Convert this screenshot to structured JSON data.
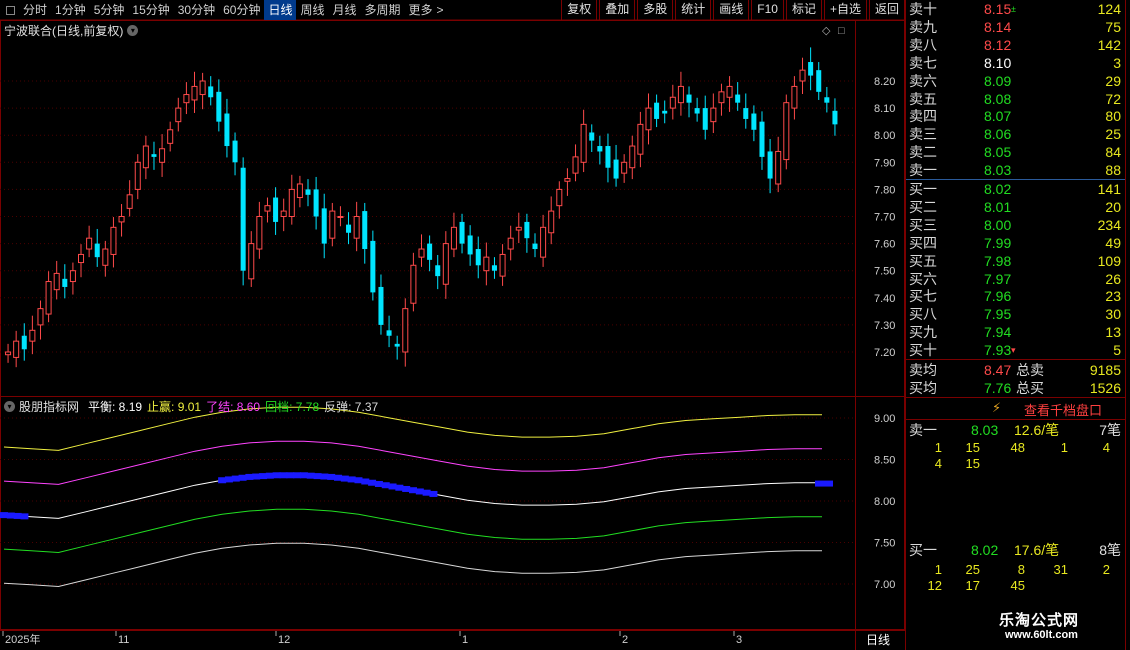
{
  "toolbar": {
    "periods": [
      "分时",
      "1分钟",
      "5分钟",
      "15分钟",
      "30分钟",
      "60分钟",
      "日线",
      "周线",
      "月线",
      "多周期",
      "更多"
    ],
    "active_period": "日线",
    "more_suffix": ">",
    "buttons": [
      "复权",
      "叠加",
      "多股",
      "统计",
      "画线",
      "F10",
      "标记",
      "+自选",
      "返回"
    ]
  },
  "stock_title": "宁波联合(日线,前复权)",
  "price_axis": [
    "8.20",
    "8.10",
    "8.00",
    "7.90",
    "7.80",
    "7.70",
    "7.60",
    "7.50",
    "7.40",
    "7.30",
    "7.20"
  ],
  "indicator": {
    "name": "股朋指标网",
    "items": [
      {
        "label": "平衡:",
        "value": "8.19",
        "color": "#ffffff"
      },
      {
        "label": "止赢:",
        "value": "9.01",
        "color": "#f0f040"
      },
      {
        "label": "了结:",
        "value": "8.60",
        "color": "#ff44ff"
      },
      {
        "label": "回档:",
        "value": "7.78",
        "color": "#22dd22"
      },
      {
        "label": "反弹:",
        "value": "7.37",
        "color": "#d8d8d8"
      }
    ],
    "axis": [
      "9.00",
      "8.50",
      "8.00",
      "7.50",
      "7.00"
    ]
  },
  "time_axis": {
    "labels": [
      "2025年",
      "11",
      "12",
      "1",
      "2",
      "3"
    ],
    "period_label": "日线"
  },
  "order_book": {
    "asks": [
      {
        "label": "卖十",
        "price": "8.15",
        "color": "red",
        "vol": "124",
        "mark": "±"
      },
      {
        "label": "卖九",
        "price": "8.14",
        "color": "red",
        "vol": "75",
        "mark": ""
      },
      {
        "label": "卖八",
        "price": "8.12",
        "color": "red",
        "vol": "142",
        "mark": ""
      },
      {
        "label": "卖七",
        "price": "8.10",
        "color": "white",
        "vol": "3",
        "mark": ""
      },
      {
        "label": "卖六",
        "price": "8.09",
        "color": "green",
        "vol": "29",
        "mark": ""
      },
      {
        "label": "卖五",
        "price": "8.08",
        "color": "green",
        "vol": "72",
        "mark": ""
      },
      {
        "label": "卖四",
        "price": "8.07",
        "color": "green",
        "vol": "80",
        "mark": ""
      },
      {
        "label": "卖三",
        "price": "8.06",
        "color": "green",
        "vol": "25",
        "mark": ""
      },
      {
        "label": "卖二",
        "price": "8.05",
        "color": "green",
        "vol": "84",
        "mark": ""
      },
      {
        "label": "卖一",
        "price": "8.03",
        "color": "green",
        "vol": "88",
        "mark": ""
      }
    ],
    "bids": [
      {
        "label": "买一",
        "price": "8.02",
        "color": "green",
        "vol": "141",
        "mark": ""
      },
      {
        "label": "买二",
        "price": "8.01",
        "color": "green",
        "vol": "20",
        "mark": ""
      },
      {
        "label": "买三",
        "price": "8.00",
        "color": "green",
        "vol": "234",
        "mark": ""
      },
      {
        "label": "买四",
        "price": "7.99",
        "color": "green",
        "vol": "49",
        "mark": ""
      },
      {
        "label": "买五",
        "price": "7.98",
        "color": "green",
        "vol": "109",
        "mark": ""
      },
      {
        "label": "买六",
        "price": "7.97",
        "color": "green",
        "vol": "26",
        "mark": ""
      },
      {
        "label": "买七",
        "price": "7.96",
        "color": "green",
        "vol": "23",
        "mark": ""
      },
      {
        "label": "买八",
        "price": "7.95",
        "color": "green",
        "vol": "30",
        "mark": ""
      },
      {
        "label": "买九",
        "price": "7.94",
        "color": "green",
        "vol": "13",
        "mark": ""
      },
      {
        "label": "买十",
        "price": "7.93",
        "color": "green",
        "vol": "5",
        "mark": "▾"
      }
    ],
    "avg_sell_label": "卖均",
    "avg_sell": "8.47",
    "total_sell_label": "总卖",
    "total_sell": "9185",
    "avg_buy_label": "买均",
    "avg_buy": "7.76",
    "total_buy_label": "总买",
    "total_buy": "1526"
  },
  "tick_detail": {
    "view_button": "查看千档盘口",
    "sell": {
      "label": "卖一",
      "price": "8.03",
      "amount": "12.6/笔",
      "count": "7笔",
      "rows": [
        [
          "1",
          "15",
          "48",
          "1",
          "4"
        ],
        [
          "4",
          "15",
          "",
          "",
          ""
        ]
      ]
    },
    "buy": {
      "label": "买一",
      "price": "8.02",
      "amount": "17.6/笔",
      "count": "8笔",
      "rows": [
        [
          "1",
          "25",
          "8",
          "31",
          "2"
        ],
        [
          "12",
          "17",
          "45",
          "",
          ""
        ]
      ]
    }
  },
  "watermark": {
    "line1": "乐淘公式网",
    "line2": "www.60lt.com"
  },
  "colors": {
    "up": "#ff4a4a",
    "down": "#00e5ff",
    "frame": "#7a0000",
    "grid": "#4a0000",
    "dots": "#1a1aff"
  }
}
